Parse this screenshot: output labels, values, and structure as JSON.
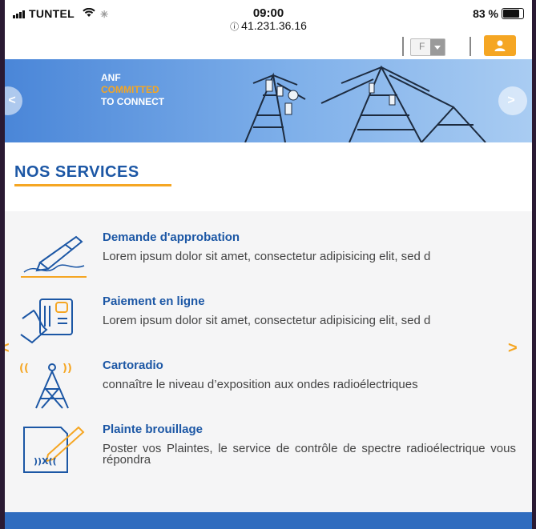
{
  "status_bar": {
    "carrier": "TUNTEL",
    "time": "09:00",
    "url": "41.231.36.16",
    "battery": "83 %"
  },
  "header": {
    "language_value": "F",
    "user_icon": "user-icon"
  },
  "hero": {
    "line1": "ANF",
    "line2": "COMMITTED",
    "line3": "TO CONNECT",
    "prev_label": "<",
    "next_label": ">"
  },
  "services": {
    "title": "NOS SERVICES",
    "items": [
      {
        "title": "Demande d'approbation",
        "desc": "Lorem ipsum dolor sit amet, consectetur adipisicing elit, sed d",
        "icon": "pen-signature-icon"
      },
      {
        "title": "Paiement en ligne",
        "desc": "Lorem ipsum dolor sit amet, consectetur adipisicing elit, sed d",
        "icon": "card-payment-icon"
      },
      {
        "title": "Cartoradio",
        "desc": "connaître le niveau d’exposition aux ondes radioélectriques",
        "icon": "antenna-tower-icon"
      },
      {
        "title": "Plainte brouillage",
        "desc": "Poster vos Plaintes, le service de contrôle de spectre radioélectrique vous répondra",
        "icon": "document-complaint-icon"
      }
    ],
    "prev_label": "<",
    "next_label": ">"
  },
  "colors": {
    "brand_blue": "#1c57a5",
    "accent_orange": "#f5a623"
  }
}
